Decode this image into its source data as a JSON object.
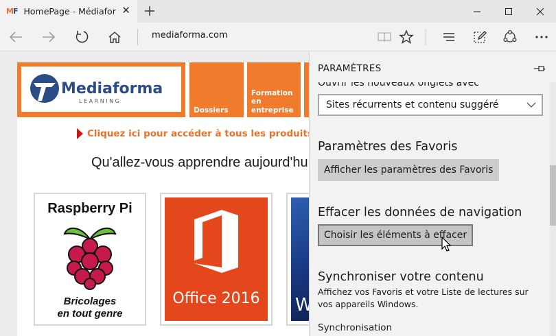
{
  "browser": {
    "tab": {
      "favicon_m": "M",
      "favicon_f": "F",
      "title": "HomePage - Médiaforma"
    },
    "address": "mediaforma.com",
    "icons": {
      "back": "back-arrow-icon",
      "forward": "forward-arrow-icon",
      "refresh": "refresh-icon",
      "home": "home-icon",
      "reading_view": "book-icon",
      "favorite": "star-icon",
      "hub": "hub-icon",
      "web_note": "pen-note-icon",
      "share": "share-icon",
      "more": "more-icon",
      "new_tab": "plus-icon",
      "tab_close": "close-icon",
      "minimize": "minimize-icon",
      "maximize": "maximize-icon",
      "close": "close-icon"
    }
  },
  "page": {
    "logo": {
      "name": "Mediaforma",
      "tagline": "L E A R N I N G"
    },
    "menu": [
      {
        "label": "Dossiers"
      },
      {
        "label": "Formation en entreprise"
      }
    ],
    "promo": "Cliquez ici pour accéder à tous les produits Médiaforma",
    "heading": "Qu'allez-vous apprendre aujourd'hui ?",
    "cards": [
      {
        "title": "Raspberry Pi",
        "subtitle_line1": "Bricolages",
        "subtitle_line2": "en tout genre"
      },
      {
        "title": "Office 2016"
      },
      {
        "title": "W"
      }
    ]
  },
  "settings": {
    "title": "PARAMÈTRES",
    "cut_label": "Ouvrir les nouveaux onglets avec",
    "new_tabs_select": "Sites récurrents et contenu suggéré",
    "favorites_section": "Paramètres des Favoris",
    "favorites_button": "Afficher les paramètres des Favoris",
    "clear_section": "Effacer les données de navigation",
    "clear_button": "Choisir les éléments à effacer",
    "sync_section": "Synchroniser votre contenu",
    "sync_desc": "Affichez vos Favoris et votre Liste de lectures sur vos appareils Windows.",
    "sync_label": "Synchronisation"
  },
  "colors": {
    "brand_orange": "#f07b2d",
    "promo_red": "#cc1515",
    "office_red": "#e3471b",
    "logo_blue": "#2c4c86"
  }
}
